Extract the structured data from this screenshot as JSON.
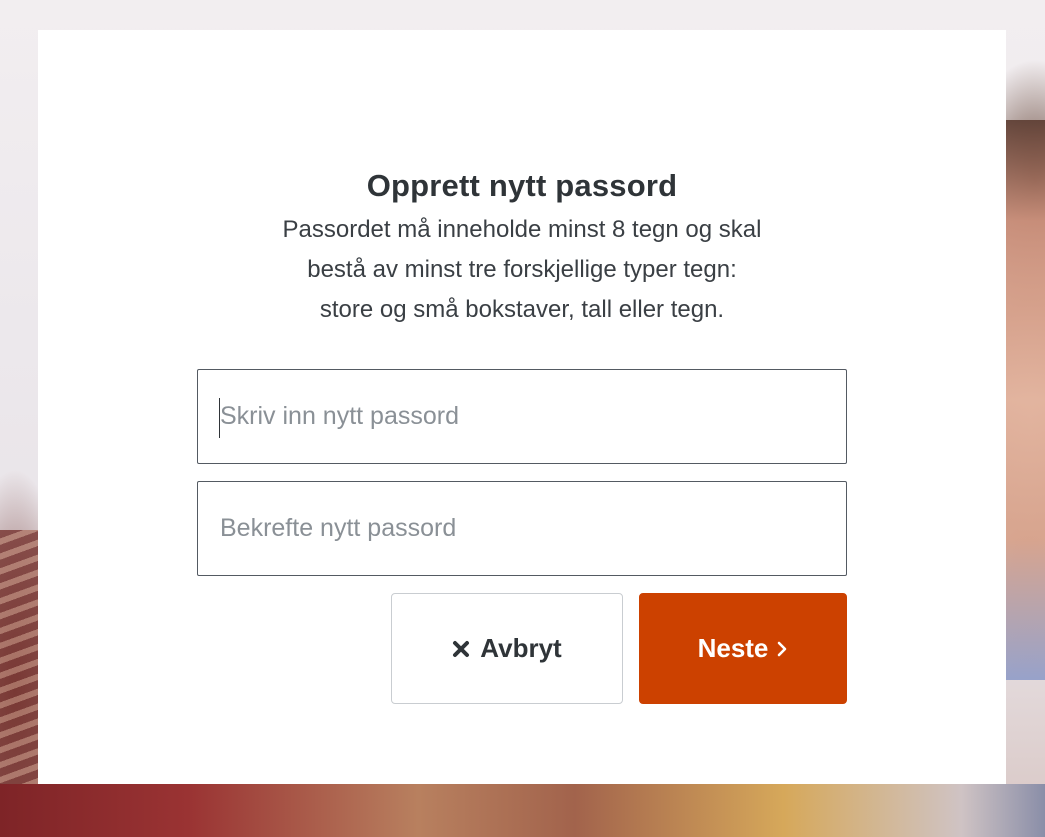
{
  "dialog": {
    "title": "Opprett nytt passord",
    "description_lines": [
      "Passordet må inneholde minst 8 tegn og skal",
      "bestå av minst tre forskjellige typer tegn:",
      "store og små bokstaver, tall eller tegn."
    ],
    "new_password": {
      "placeholder": "Skriv inn nytt passord",
      "value": ""
    },
    "confirm_password": {
      "placeholder": "Bekrefte nytt passord",
      "value": ""
    },
    "cancel_button": {
      "label": "Avbryt",
      "icon": "close-icon"
    },
    "next_button": {
      "label": "Neste",
      "icon": "chevron-right-icon"
    }
  },
  "colors": {
    "primary": "#cc4100",
    "text": "#2f3438",
    "placeholder": "#8a9096",
    "field_border": "#545a62",
    "cancel_border": "#c9cdd1"
  }
}
